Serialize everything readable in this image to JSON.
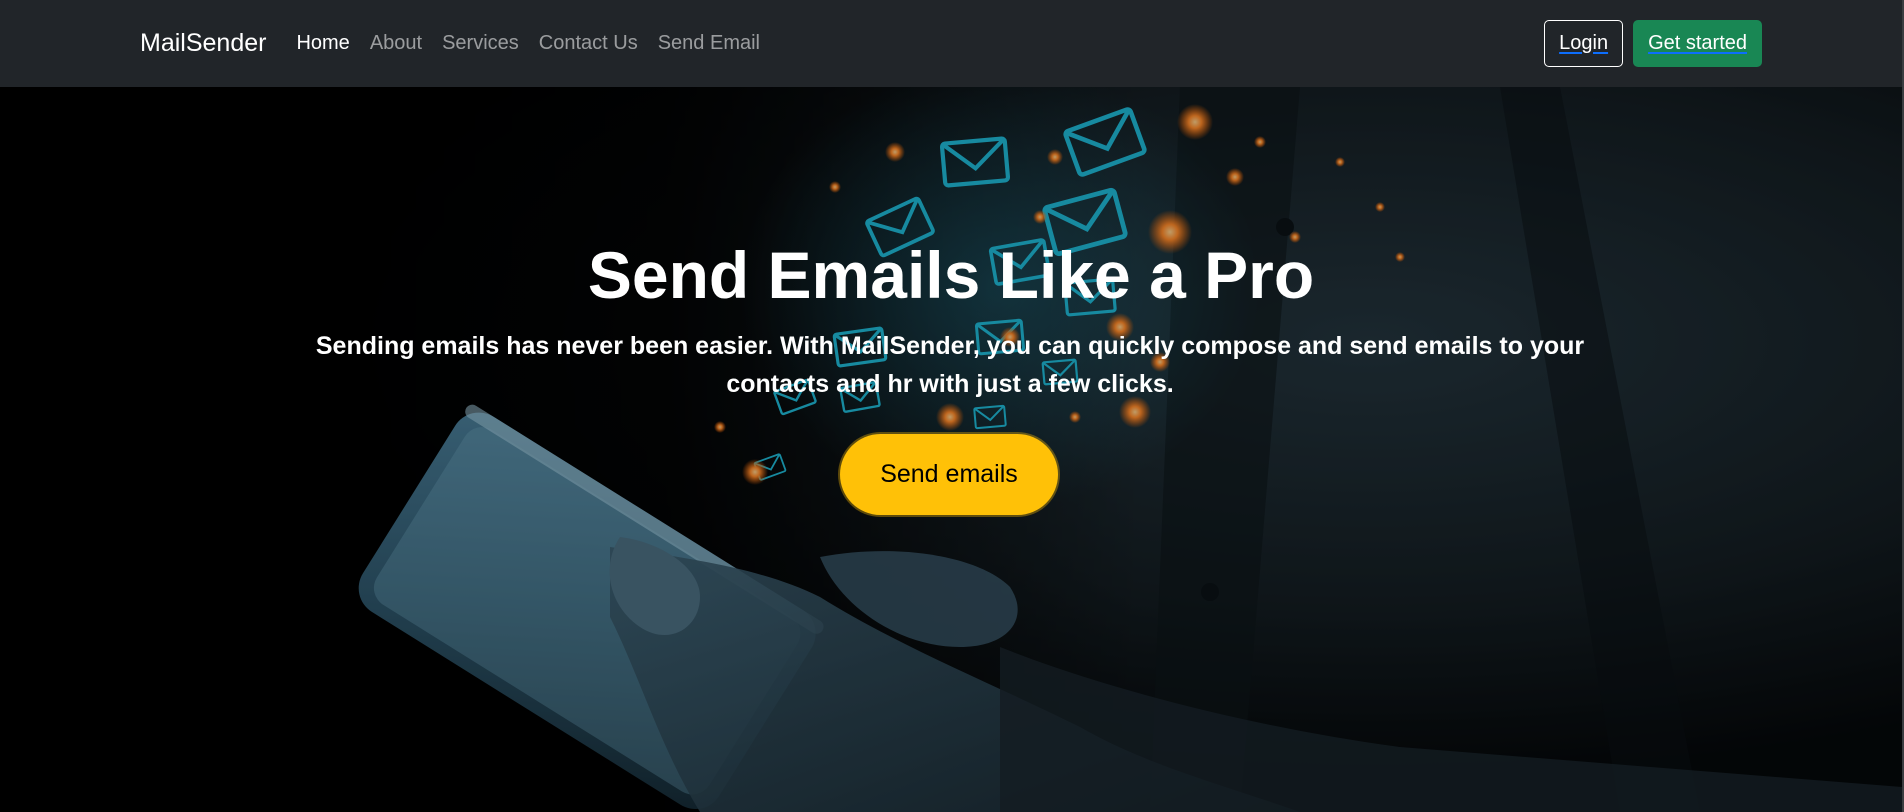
{
  "navbar": {
    "brand": "MailSender",
    "links": [
      {
        "label": "Home",
        "active": true
      },
      {
        "label": "About",
        "active": false
      },
      {
        "label": "Services",
        "active": false
      },
      {
        "label": "Contact Us",
        "active": false
      },
      {
        "label": "Send Email",
        "active": false
      }
    ],
    "login_label": "Login",
    "get_started_label": "Get started"
  },
  "hero": {
    "title": "Send Emails Like a Pro",
    "subtitle": "Sending emails has never been easier. With MailSender, you can quickly compose and send emails to your contacts and hr with just a few clicks.",
    "cta_label": "Send emails",
    "background_image": "phone-with-flying-email-envelopes-photo"
  },
  "colors": {
    "navbar_bg": "#212529",
    "nav_active": "#ffffff",
    "nav_inactive": "#8c8f92",
    "get_started_bg": "#198754",
    "cta_bg": "#ffc107",
    "envelope_glow": "#1fb8d6",
    "spark": "#ff8a2a"
  }
}
